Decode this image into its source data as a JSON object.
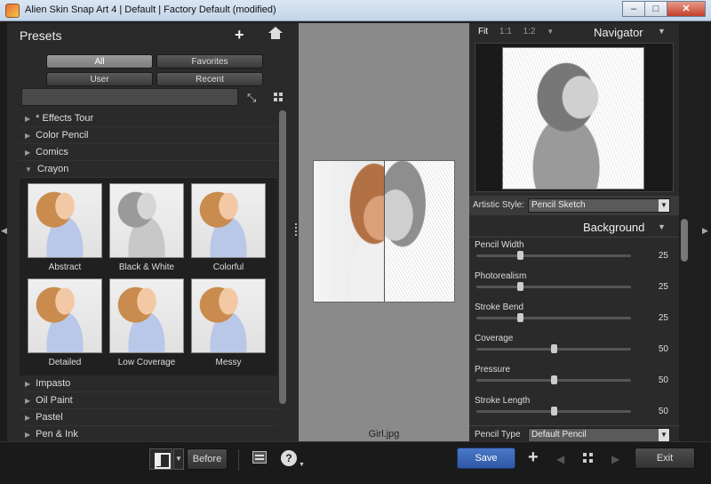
{
  "window": {
    "title": "Alien Skin Snap Art 4 | Default | Factory Default (modified)",
    "minimize": "–",
    "maximize": "□",
    "close": "✕"
  },
  "presets": {
    "title": "Presets",
    "filters": [
      "All",
      "Favorites",
      "User",
      "Recent"
    ],
    "active_filter": "All",
    "search_value": "",
    "categories_top": [
      "* Effects Tour",
      "Color Pencil",
      "Comics",
      "Crayon"
    ],
    "expanded_category": "Crayon",
    "thumbnails": [
      {
        "label": "Abstract",
        "style": "color"
      },
      {
        "label": "Black & White",
        "style": "bw"
      },
      {
        "label": "Colorful",
        "style": "color"
      },
      {
        "label": "Detailed",
        "style": "color"
      },
      {
        "label": "Low Coverage",
        "style": "color"
      },
      {
        "label": "Messy",
        "style": "color"
      }
    ],
    "categories_bottom": [
      "Impasto",
      "Oil Paint",
      "Pastel",
      "Pen & Ink"
    ]
  },
  "preview": {
    "filename": "Girl.jpg"
  },
  "navigator": {
    "zoom_options": [
      "Fit",
      "1:1",
      "1:2"
    ],
    "active_zoom": "Fit",
    "title": "Navigator"
  },
  "settings": {
    "artistic_style_label": "Artistic Style:",
    "artistic_style_value": "Pencil Sketch",
    "section_title": "Background",
    "sliders": [
      {
        "label": "Pencil Width",
        "value": "25",
        "fraction": 0.28
      },
      {
        "label": "Photorealism",
        "value": "25",
        "fraction": 0.28
      },
      {
        "label": "Stroke Bend",
        "value": "25",
        "fraction": 0.28
      },
      {
        "label": "Coverage",
        "value": "50",
        "fraction": 0.5
      },
      {
        "label": "Pressure",
        "value": "50",
        "fraction": 0.5
      },
      {
        "label": "Stroke Length",
        "value": "50",
        "fraction": 0.5
      }
    ],
    "pencil_type_label": "Pencil Type",
    "pencil_type_value": "Default Pencil"
  },
  "bottom": {
    "before_label": "Before",
    "save_label": "Save",
    "exit_label": "Exit",
    "help_glyph": "?"
  },
  "colors": {
    "accent": "#3b68b8",
    "panel": "#2a2a2a",
    "canvas": "#8a8a8a"
  }
}
